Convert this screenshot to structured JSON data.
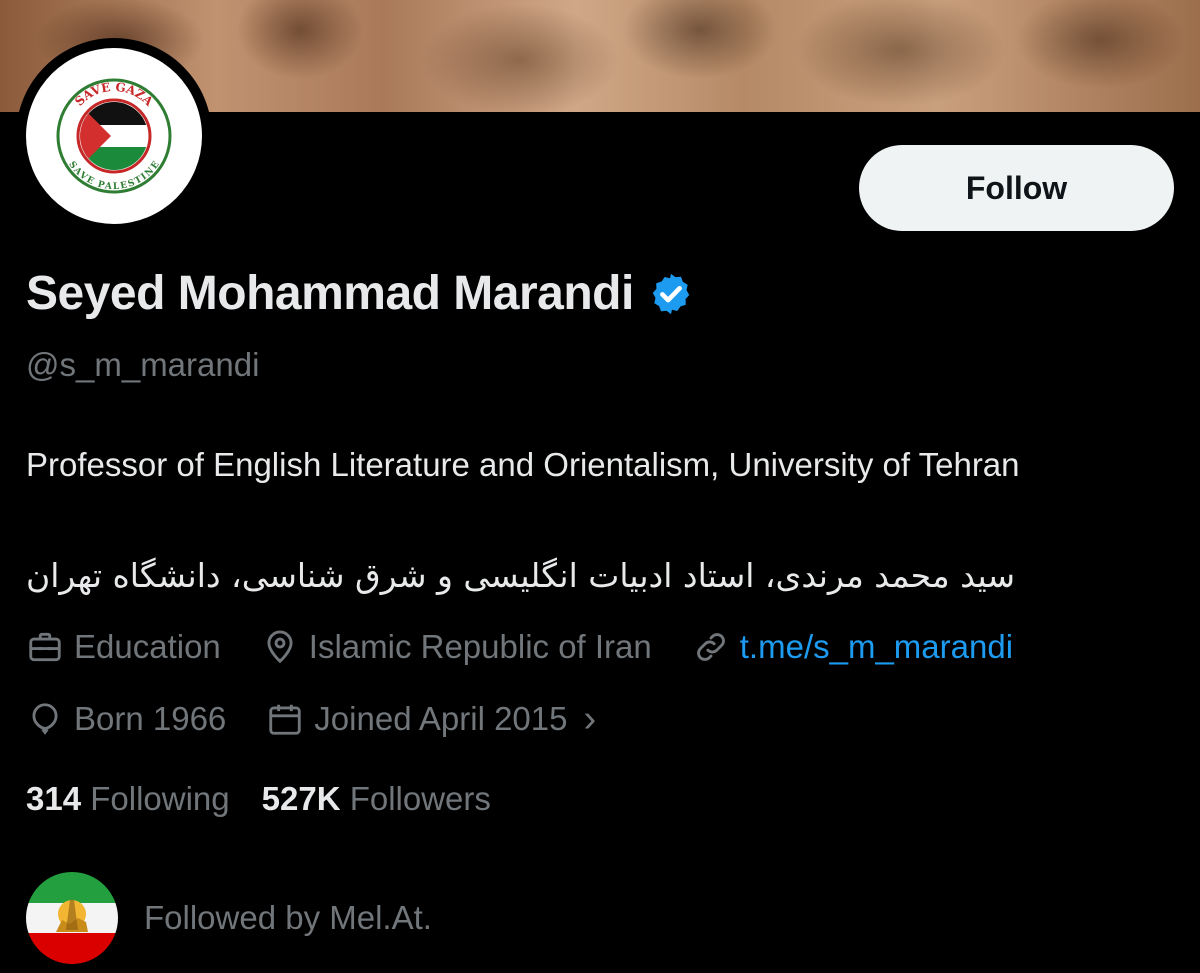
{
  "profile": {
    "name": "Seyed Mohammad Marandi",
    "handle": "@s_m_marandi",
    "bio_en": "Professor of English Literature and Orientalism, University of Tehran",
    "bio_fa": "سید محمد مرندی، استاد ادبیات انگلیسی و شرق شناسی، دانشگاه تهران",
    "avatar_text_top": "SAVE GAZA",
    "avatar_text_bottom": "SAVE PALESTINE",
    "verified": true
  },
  "actions": {
    "follow_label": "Follow"
  },
  "meta": {
    "category": "Education",
    "location": "Islamic Republic of Iran",
    "link": "t.me/s_m_marandi",
    "born": "Born 1966",
    "joined": "Joined April 2015",
    "joined_chevron": "›"
  },
  "stats": {
    "following_count": "314",
    "following_label": "Following",
    "followers_count": "527K",
    "followers_label": "Followers"
  },
  "followed_by": {
    "text": "Followed by Mel.At."
  },
  "colors": {
    "background": "#000000",
    "text_primary": "#e7e9ea",
    "text_secondary": "#71767b",
    "link": "#1d9bf0",
    "verified": "#1d9bf0",
    "follow_button_bg": "#eff3f4"
  },
  "icons": [
    "briefcase-icon",
    "location-pin-icon",
    "link-icon",
    "balloon-icon",
    "calendar-icon",
    "chevron-right-icon",
    "verified-badge-icon"
  ]
}
